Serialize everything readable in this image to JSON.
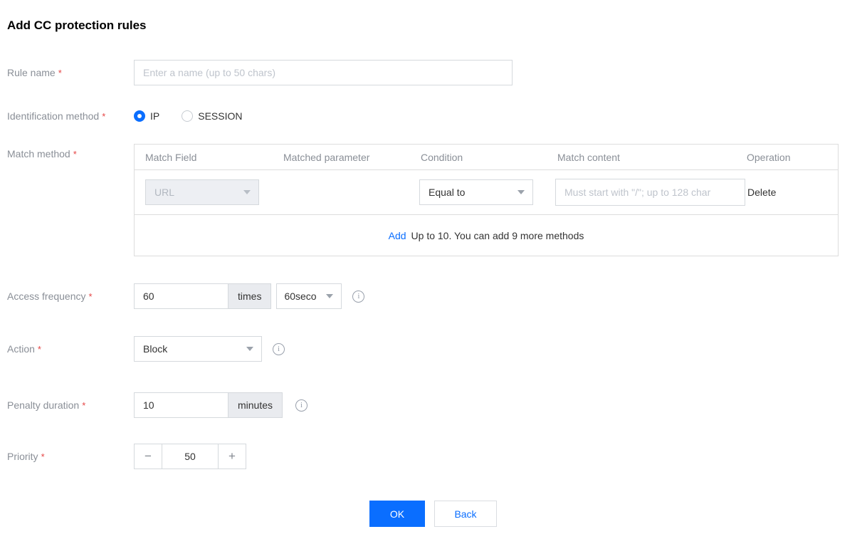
{
  "title": "Add CC protection rules",
  "colors": {
    "accent": "#0a6eff",
    "required": "#e54545"
  },
  "icons": {
    "info": "i",
    "minus": "−",
    "plus": "+"
  },
  "fields": {
    "rule_name": {
      "label": "Rule name",
      "required_mark": "*",
      "placeholder": "Enter a name (up to 50 chars)"
    },
    "identification_method": {
      "label": "Identification method",
      "required_mark": "*",
      "options": [
        {
          "label": "IP",
          "selected": true
        },
        {
          "label": "SESSION",
          "selected": false
        }
      ]
    },
    "match_method": {
      "label": "Match method",
      "required_mark": "*"
    },
    "access_frequency": {
      "label": "Access frequency",
      "required_mark": "*",
      "value": "60",
      "unit": "times",
      "period": "60seco"
    },
    "action": {
      "label": "Action",
      "required_mark": "*",
      "value": "Block"
    },
    "penalty_duration": {
      "label": "Penalty duration",
      "required_mark": "*",
      "value": "10",
      "unit": "minutes"
    },
    "priority": {
      "label": "Priority",
      "required_mark": "*",
      "value": "50"
    }
  },
  "match_table": {
    "headers": {
      "field": "Match Field",
      "parameter": "Matched parameter",
      "condition": "Condition",
      "content": "Match content",
      "operation": "Operation"
    },
    "row": {
      "field_value": "URL",
      "condition_value": "Equal to",
      "content_placeholder": "Must start with \"/\"; up to 128 char",
      "delete_label": "Delete"
    },
    "footer": {
      "add_label": "Add",
      "hint": "Up to 10. You can add 9 more methods"
    }
  },
  "buttons": {
    "ok": "OK",
    "back": "Back"
  }
}
